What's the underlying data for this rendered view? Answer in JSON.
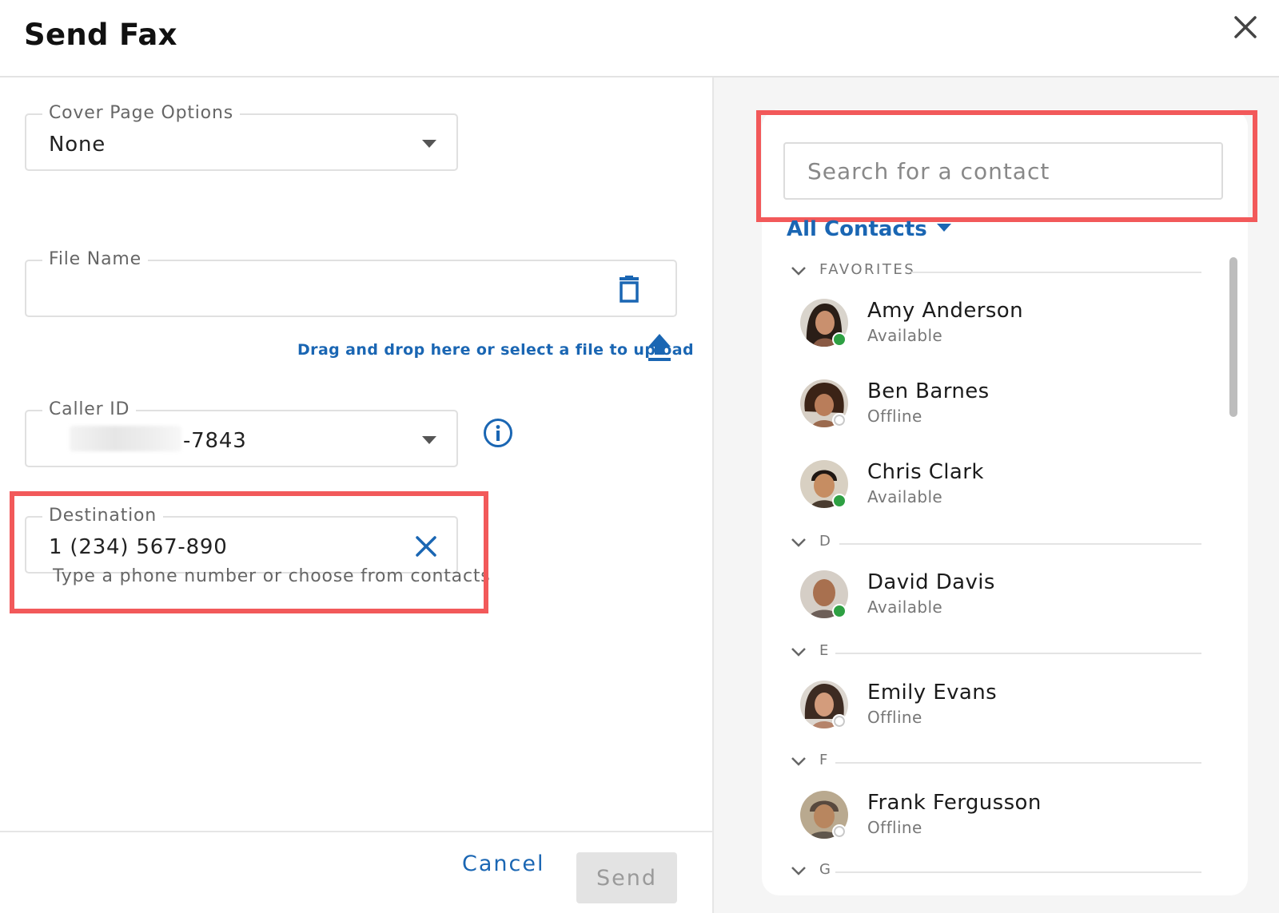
{
  "dialog": {
    "title": "Send Fax"
  },
  "form": {
    "cover_page": {
      "label": "Cover Page Options",
      "value": "None"
    },
    "file_name": {
      "label": "File Name",
      "value": ""
    },
    "upload": {
      "text": "Drag and drop here or select a file to upload"
    },
    "caller_id": {
      "label": "Caller ID",
      "value": "-7843"
    },
    "destination": {
      "label": "Destination",
      "value": "1 (234) 567-890",
      "helper": "Type a phone number or choose from contacts"
    }
  },
  "footer": {
    "cancel": "Cancel",
    "send": "Send"
  },
  "contacts": {
    "search_placeholder": "Search for a contact",
    "filter": "All Contacts",
    "sections": [
      {
        "label": "FAVORITES"
      },
      {
        "label": "D"
      },
      {
        "label": "E"
      },
      {
        "label": "F"
      },
      {
        "label": "G"
      }
    ],
    "items": [
      {
        "name": "Amy Anderson",
        "status": "Available"
      },
      {
        "name": "Ben Barnes",
        "status": "Offline"
      },
      {
        "name": "Chris Clark",
        "status": "Available"
      },
      {
        "name": "David Davis",
        "status": "Available"
      },
      {
        "name": "Emily Evans",
        "status": "Offline"
      },
      {
        "name": "Frank Fergusson",
        "status": "Offline"
      }
    ]
  },
  "colors": {
    "accent": "#1a66b3",
    "highlight": "#f2595a",
    "available": "#2ea043"
  },
  "icons": [
    "close-icon",
    "caret-down-icon",
    "trash-icon",
    "upload-icon",
    "info-icon",
    "clear-icon",
    "chevron-down-icon"
  ]
}
